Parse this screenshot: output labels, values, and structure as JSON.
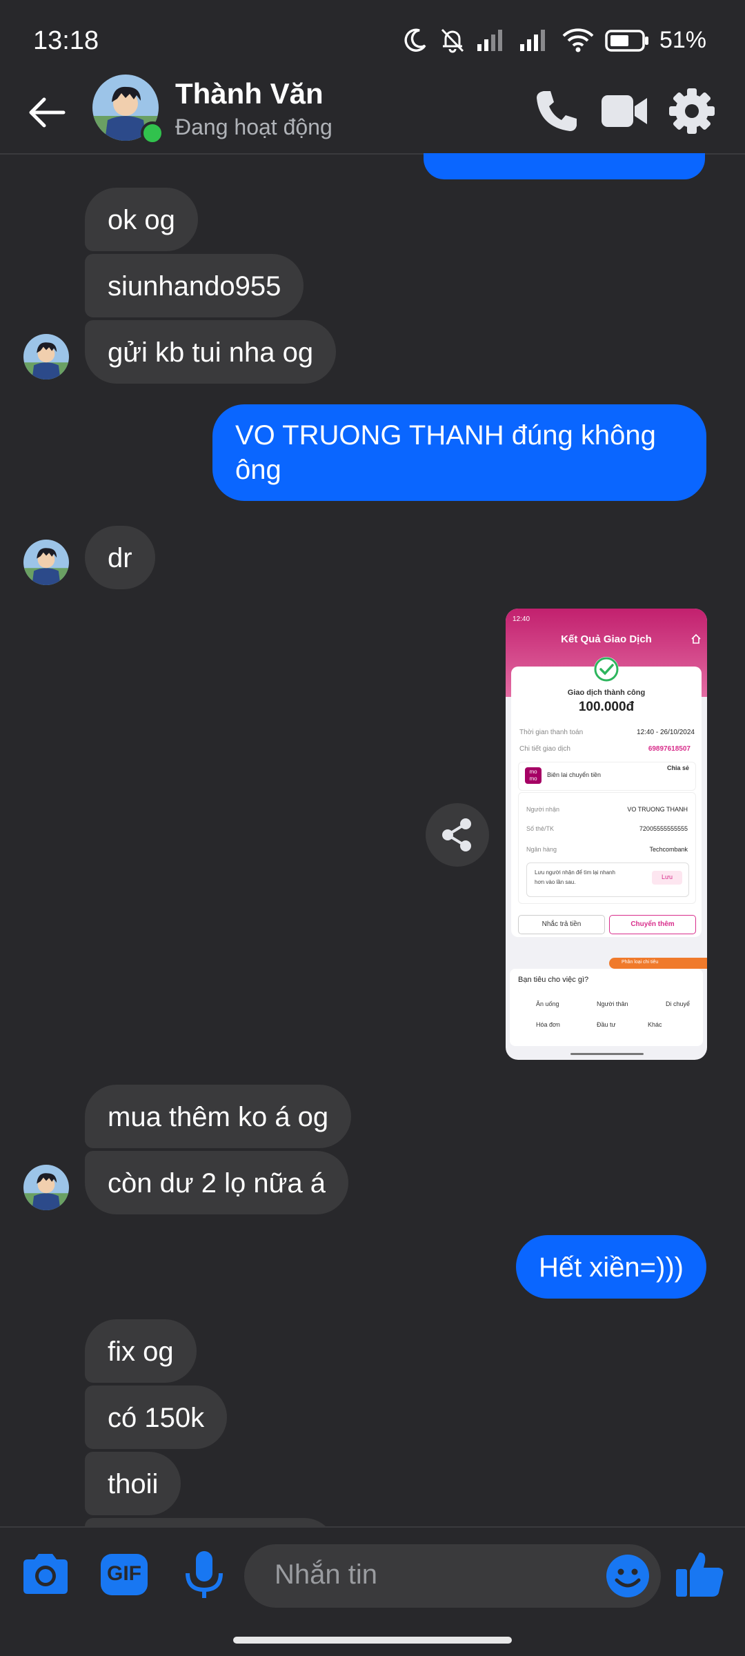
{
  "status": {
    "time": "13:18",
    "battery": "51%"
  },
  "header": {
    "name": "Thành Văn",
    "status": "Đang hoạt động"
  },
  "messages": [
    {
      "text": "ok og"
    },
    {
      "text": "siunhando955"
    },
    {
      "text": "gửi kb tui nha og"
    },
    {
      "line1": "VO TRUONG THANH đúng không",
      "line2": "ông"
    },
    {
      "text": "dr"
    },
    {
      "text": "mua thêm ko á og"
    },
    {
      "text": "còn dư 2 lọ nữa á"
    },
    {
      "text": "Hết xiền=)))"
    },
    {
      "text": "fix og"
    },
    {
      "text": "có 150k"
    },
    {
      "text": "thoii"
    }
  ],
  "screenshot": {
    "time": "12:40",
    "title": "Kết Quả Giao Dịch",
    "success": "Giao dịch thành công",
    "amount": "100.000đ",
    "time_label": "Thời gian thanh toán",
    "time_value": "12:40 - 26/10/2024",
    "detail_label": "Chi tiết giao dịch",
    "detail_value": "69897618507",
    "receipt": "Biên lai chuyển tiền",
    "share": "Chia sẻ",
    "recipient_label": "Người nhận",
    "recipient": "VO TRUONG THANH",
    "card_label": "Số thẻ/TK",
    "card": "72005555555555",
    "bank_label": "Ngân hàng",
    "bank": "Techcombank",
    "save_hint1": "Lưu người nhận để tìm lại nhanh",
    "save_hint2": "hơn vào lần sau.",
    "save": "Lưu",
    "remind": "Nhắc trả tiền",
    "transfer_more": "Chuyển thêm",
    "category_banner": "Phân loại chi tiêu",
    "spend_q": "Bạn tiêu cho việc gì?",
    "cats": [
      "Ăn uống",
      "Người thân",
      "Di chuyể",
      "Hóa đơn",
      "Đầu tư",
      "Khác"
    ],
    "logo": "mo mo"
  },
  "composer": {
    "placeholder": "Nhắn tin",
    "gif": "GIF"
  },
  "colors": {
    "background": "#28282b",
    "incoming": "#3a3a3c",
    "outgoing": "#0a66ff",
    "accent": "#1877f2",
    "momo": "#d82d8b"
  }
}
